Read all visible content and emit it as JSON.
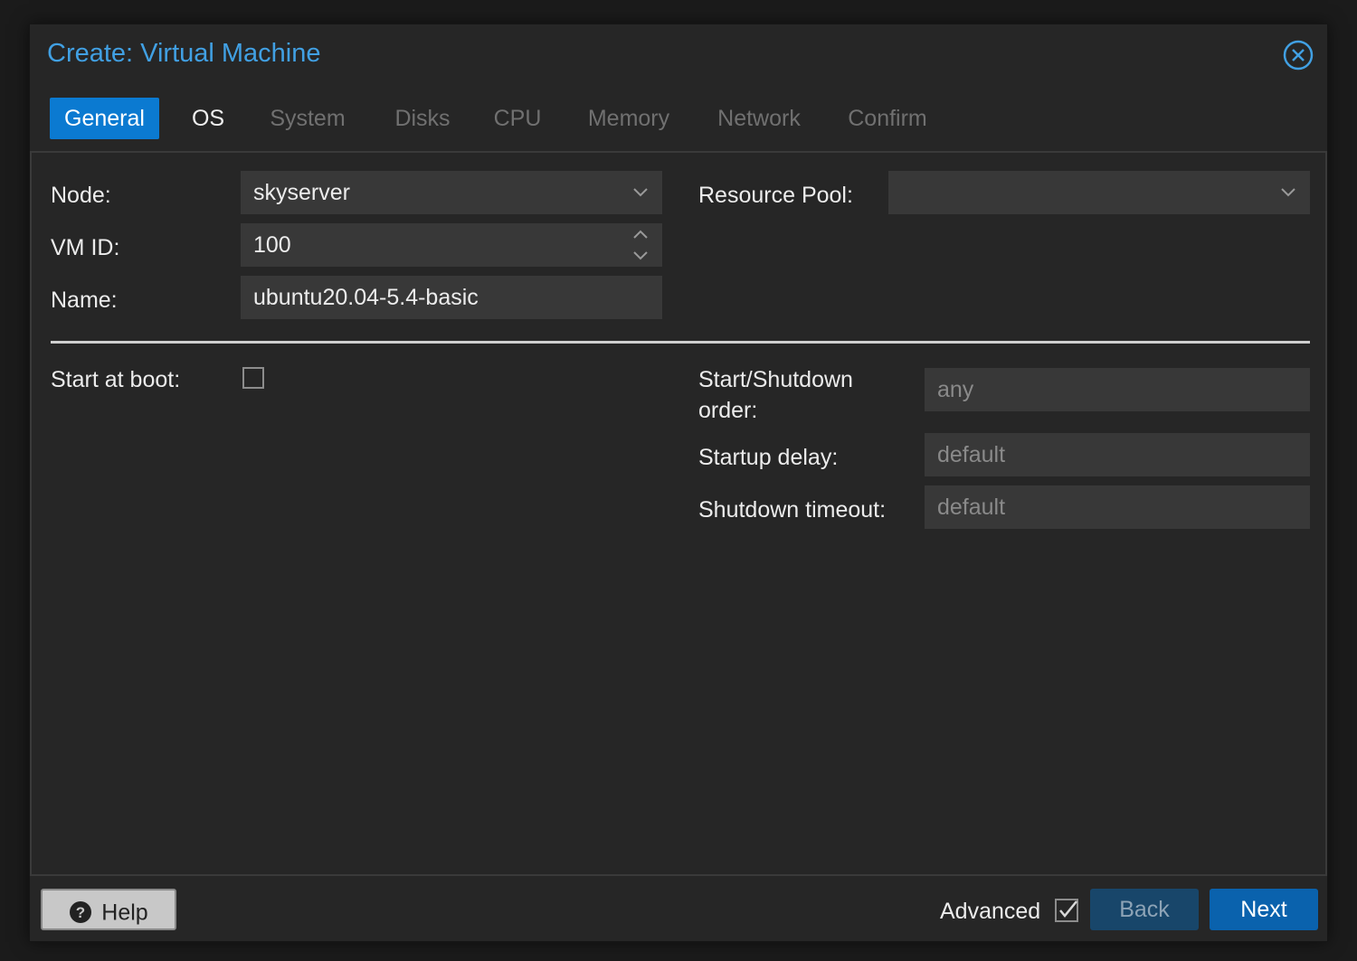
{
  "window": {
    "title": "Create: Virtual Machine"
  },
  "tabs": [
    {
      "label": "General",
      "state": "active"
    },
    {
      "label": "OS",
      "state": "enabled"
    },
    {
      "label": "System",
      "state": "disabled"
    },
    {
      "label": "Disks",
      "state": "disabled"
    },
    {
      "label": "CPU",
      "state": "disabled"
    },
    {
      "label": "Memory",
      "state": "disabled"
    },
    {
      "label": "Network",
      "state": "disabled"
    },
    {
      "label": "Confirm",
      "state": "disabled"
    }
  ],
  "general": {
    "node": {
      "label": "Node:",
      "value": "skyserver"
    },
    "vmid": {
      "label": "VM ID:",
      "value": "100"
    },
    "name": {
      "label": "Name:",
      "value": "ubuntu20.04-5.4-basic"
    },
    "resource_pool": {
      "label": "Resource Pool:",
      "value": ""
    },
    "start_at_boot": {
      "label": "Start at boot:",
      "checked": false
    },
    "start_order": {
      "label_line1": "Start/Shutdown",
      "label_line2": "order:",
      "placeholder": "any"
    },
    "startup_delay": {
      "label": "Startup delay:",
      "placeholder": "default"
    },
    "shutdown_timeout": {
      "label": "Shutdown timeout:",
      "placeholder": "default"
    }
  },
  "footer": {
    "help_label": "Help",
    "advanced_label": "Advanced",
    "advanced_checked": true,
    "back_label": "Back",
    "next_label": "Next"
  },
  "colors": {
    "accent": "#0b7ad1",
    "title": "#41a0e3",
    "background": "#262626",
    "field": "#383838"
  },
  "icons": [
    "close-icon",
    "chevron-down-icon",
    "spinner-icon",
    "help-icon",
    "checkbox-checked-icon"
  ]
}
